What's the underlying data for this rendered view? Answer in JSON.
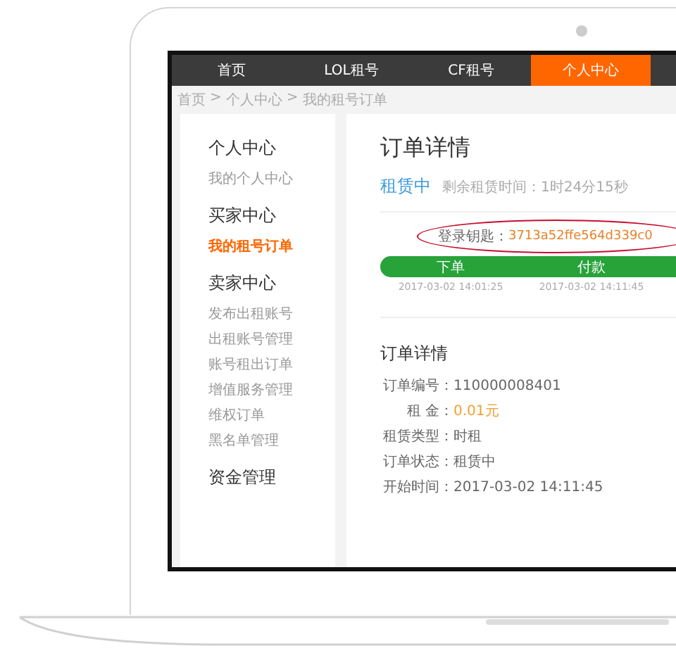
{
  "nav": {
    "tabs": [
      {
        "label": "首页",
        "selected": false
      },
      {
        "label": "LOL租号",
        "selected": false
      },
      {
        "label": "CF租号",
        "selected": false
      },
      {
        "label": "个人中心",
        "selected": true
      }
    ]
  },
  "breadcrumb": [
    "首页",
    "个人中心",
    "我的租号订单"
  ],
  "breadcrumb_separator": ">",
  "sidebar": {
    "groups": [
      {
        "title": "个人中心",
        "items": [
          {
            "label": "我的个人中心",
            "selected": false
          }
        ]
      },
      {
        "title": "买家中心",
        "items": [
          {
            "label": "我的租号订单",
            "selected": true
          }
        ]
      },
      {
        "title": "卖家中心",
        "items": [
          {
            "label": "发布出租账号",
            "selected": false
          },
          {
            "label": "出租账号管理",
            "selected": false
          },
          {
            "label": "账号租出订单",
            "selected": false
          },
          {
            "label": "增值服务管理",
            "selected": false
          },
          {
            "label": "维权订单",
            "selected": false
          },
          {
            "label": "黑名单管理",
            "selected": false
          }
        ]
      },
      {
        "title": "资金管理"
      }
    ]
  },
  "order": {
    "title": "订单详情",
    "status": "租赁中",
    "remaining": "剩余租赁时间：1时24分15秒",
    "login_key": {
      "label": "登录钥匙：",
      "value": "3713a52ffe564d339c0"
    },
    "steps": [
      {
        "label": "下单",
        "time": "2017-03-02 14:01:25",
        "done": true
      },
      {
        "label": "付款",
        "time": "2017-03-02 14:11:45",
        "done": true
      }
    ],
    "progress": {
      "level": 1
    },
    "details_title": "订单详情",
    "details": [
      {
        "label": "订单编号：",
        "value": "110000008401",
        "kind": "text"
      },
      {
        "label": "租 金：",
        "value": "0.01元",
        "kind": "price"
      },
      {
        "label": "租赁类型：",
        "value": "时租",
        "kind": "text"
      },
      {
        "label": "订单状态：",
        "value": "租赁中",
        "kind": "text"
      },
      {
        "label": "开始时间：",
        "value": "2017-03-02 14:11:45",
        "kind": "text"
      }
    ]
  }
}
